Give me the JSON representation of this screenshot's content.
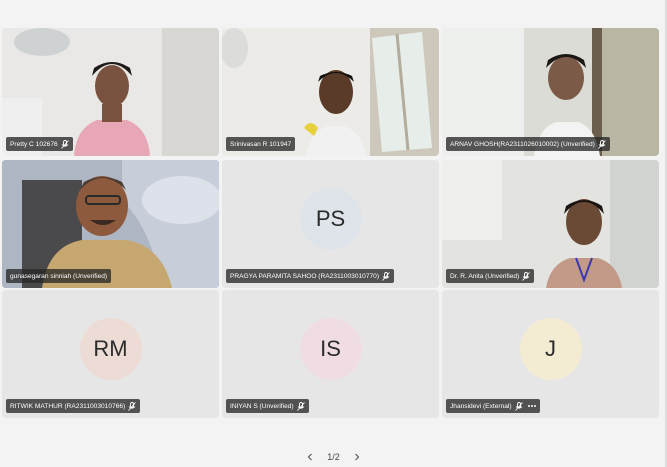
{
  "participants": [
    {
      "name": "Pretty C 102676",
      "type": "video"
    },
    {
      "name": "Srinivasan R 101947",
      "type": "video"
    },
    {
      "name": "ARNAV GHOSH(RA2311026010002) (Unverified)",
      "type": "video"
    },
    {
      "name": "gunasegaran sinniah (Unverified)",
      "type": "video",
      "active": true
    },
    {
      "name": "PRAGYA PARAMITA SAHOO (RA2311003010770)",
      "type": "avatar",
      "initials": "PS",
      "avatar_color": "#dfe3ea"
    },
    {
      "name": "Dr. R. Anita (Unverified)",
      "type": "video"
    },
    {
      "name": "RITWIK MATHUR (RA2311003010766)",
      "type": "avatar",
      "initials": "RM",
      "avatar_color": "#ecdcd5"
    },
    {
      "name": "INIYAN S (Unverified)",
      "type": "avatar",
      "initials": "IS",
      "avatar_color": "#f0dde4"
    },
    {
      "name": "Jhansidevi (External)",
      "type": "avatar",
      "initials": "J",
      "avatar_color": "#f3ecd2"
    }
  ],
  "pager": {
    "label": "1/2"
  },
  "icons": {
    "muted_mic": "mic-off-icon",
    "prev": "chevron-left-icon",
    "next": "chevron-right-icon",
    "more": "more-icon"
  }
}
